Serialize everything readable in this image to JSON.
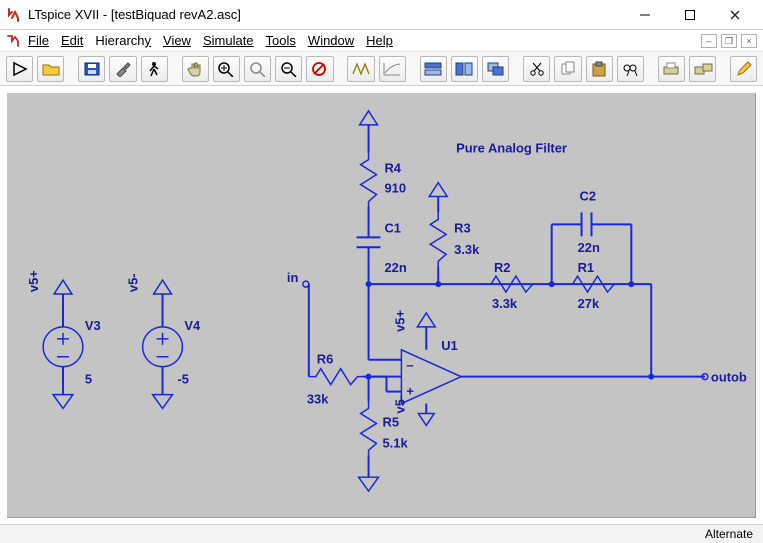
{
  "titlebar": {
    "title": "LTspice XVII - [testBiquad revA2.asc]"
  },
  "menus": {
    "file": "File",
    "edit": "Edit",
    "hierarchy": "Hierarchy",
    "view": "View",
    "simulate": "Simulate",
    "tools": "Tools",
    "window": "Window",
    "help": "Help"
  },
  "schematic": {
    "title": "Pure Analog Filter",
    "labels": {
      "in": "in",
      "outob": "outob",
      "v5plus": "v5+",
      "v5minus": "v5-",
      "v5plus_rail": "v5+",
      "v5minus_rail": "v5-"
    },
    "components": {
      "V3": {
        "name": "V3",
        "value": "5"
      },
      "V4": {
        "name": "V4",
        "value": "-5"
      },
      "R1": {
        "name": "R1",
        "value": "27k"
      },
      "R2": {
        "name": "R2",
        "value": "3.3k"
      },
      "R3": {
        "name": "R3",
        "value": "3.3k"
      },
      "R4": {
        "name": "R4",
        "value": "910"
      },
      "R5": {
        "name": "R5",
        "value": "5.1k"
      },
      "R6": {
        "name": "R6",
        "value": "33k"
      },
      "C1": {
        "name": "C1",
        "value": "22n"
      },
      "C2": {
        "name": "C2",
        "value": "22n"
      },
      "U1": {
        "name": "U1"
      }
    }
  },
  "status": {
    "mode": "Alternate"
  }
}
